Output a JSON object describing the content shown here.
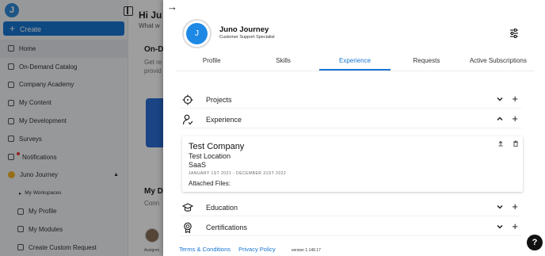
{
  "sidebar": {
    "logo": "J",
    "create_label": "Create",
    "items": [
      {
        "label": "Home"
      },
      {
        "label": "On-Demand Catalog"
      },
      {
        "label": "Company Academy"
      },
      {
        "label": "My Content"
      },
      {
        "label": "My Development"
      },
      {
        "label": "Surveys"
      },
      {
        "label": "Notifications"
      },
      {
        "label": "Juno Journey"
      },
      {
        "label": "My Workspaces"
      },
      {
        "label": "My Profile"
      },
      {
        "label": "My Modules"
      },
      {
        "label": "Create Custom Request"
      }
    ]
  },
  "main": {
    "greeting": "Hi Ju",
    "greeting_sub": "What w",
    "on_demand_title": "On-D",
    "on_demand_sub": "Get re provid",
    "my_dev_title": "My D",
    "my_dev_sub": "Conn",
    "assign_label": "Assignm"
  },
  "drawer": {
    "back_icon": "arrow-right-icon",
    "avatar_initial": "J",
    "name": "Juno Journey",
    "role": "Customer Support Specialist",
    "tabs": [
      {
        "label": "Profile",
        "active": false
      },
      {
        "label": "Skills",
        "active": false
      },
      {
        "label": "Experience",
        "active": true
      },
      {
        "label": "Requests",
        "active": false
      },
      {
        "label": "Active Subscriptions",
        "active": false
      }
    ],
    "sections": {
      "projects": "Projects",
      "experience": "Experience",
      "education": "Education",
      "certifications": "Certifications"
    },
    "experience_entry": {
      "company": "Test Company",
      "location": "Test Location",
      "industry": "SaaS",
      "dates": "JANUARY 1ST 2021 - DECEMBER 31ST 2022",
      "attached_files": "Attached Files:"
    },
    "footer": {
      "terms": "Terms & Conditions",
      "privacy": "Privacy Policy",
      "version": "version 1.149.17"
    }
  },
  "help_label": "?",
  "colors": {
    "accent": "#1976d2",
    "avatar": "#1e88e5"
  }
}
